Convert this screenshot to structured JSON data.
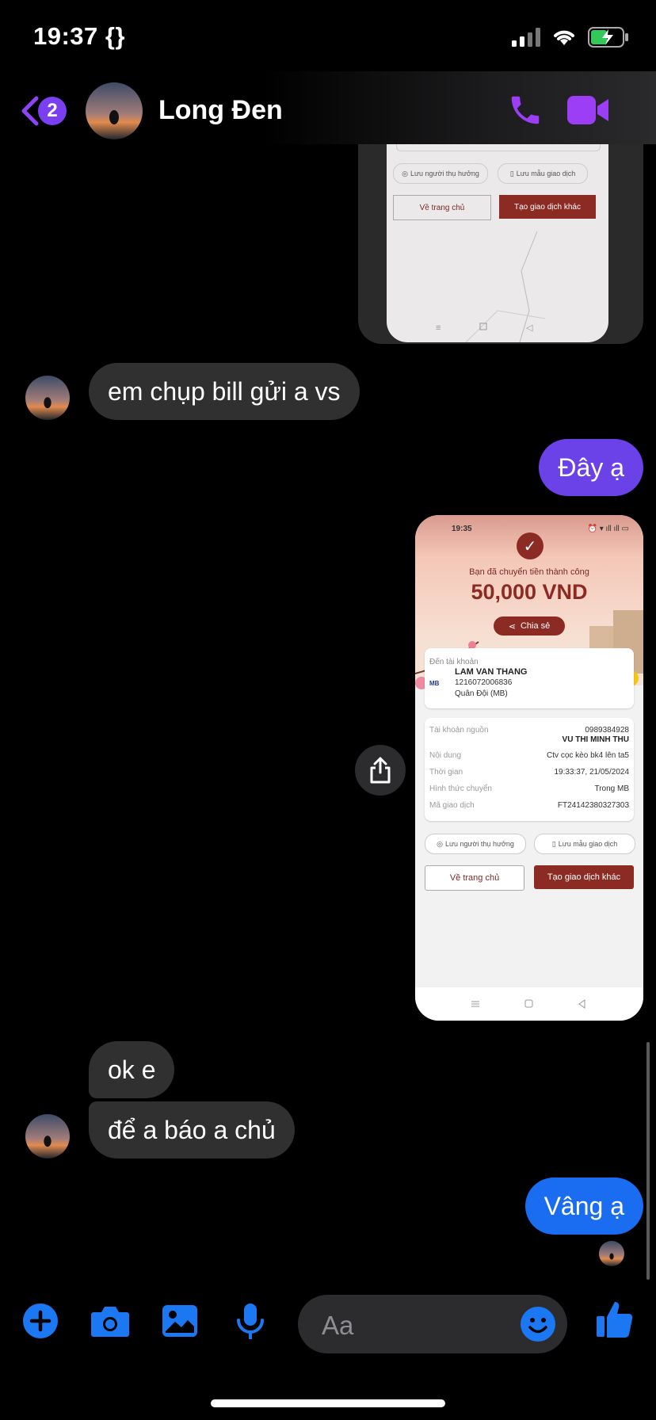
{
  "status_bar": {
    "time": "19:37 {}"
  },
  "header": {
    "unread_count": "2",
    "contact_name": "Long Đen"
  },
  "top_receipt": {
    "save_recipient": "Lưu người thụ hưởng",
    "save_template": "Lưu mẫu giao dịch",
    "home_button": "Về trang chủ",
    "new_transaction_button": "Tạo giao dịch khác"
  },
  "messages": [
    {
      "from": "contact",
      "text": "em chụp bill gửi a vs"
    },
    {
      "from": "me",
      "text": "Đây ạ"
    },
    {
      "from": "contact",
      "text": "ok e"
    },
    {
      "from": "contact",
      "text": "để a báo a chủ"
    },
    {
      "from": "me",
      "text": "Vâng ạ"
    }
  ],
  "receipt": {
    "time": "19:35",
    "success_text": "Bạn đã chuyển tiền thành công",
    "amount": "50,000 VND",
    "share_label": "Chia sẻ",
    "to_account_label": "Đến tài khoản",
    "recipient_name": "LAM VAN THANG",
    "recipient_account": "1216072006836",
    "recipient_bank": "Quân Đội (MB)",
    "bank_logo": "MB",
    "rows": [
      {
        "label": "Tài khoản nguồn",
        "value": "0989384928",
        "value2": "VU THI MINH THU"
      },
      {
        "label": "Nội dung",
        "value": "Ctv cọc kèo bk4 lên ta5"
      },
      {
        "label": "Thời gian",
        "value": "19:33:37, 21/05/2024"
      },
      {
        "label": "Hình thức chuyển",
        "value": "Trong MB"
      },
      {
        "label": "Mã giao dịch",
        "value": "FT24142380327303"
      }
    ],
    "save_recipient": "Lưu người thụ hưởng",
    "save_template": "Lưu mẫu giao dịch",
    "home_button": "Về trang chủ",
    "new_transaction_button": "Tạo giao dịch khác"
  },
  "composer": {
    "placeholder": "Aa"
  },
  "colors": {
    "accent_purple": "#7b3ff2",
    "bubble_blue": "#1a6cf1",
    "bubble_purple": "#6b41e8",
    "icon_blue": "#1b78f2"
  }
}
